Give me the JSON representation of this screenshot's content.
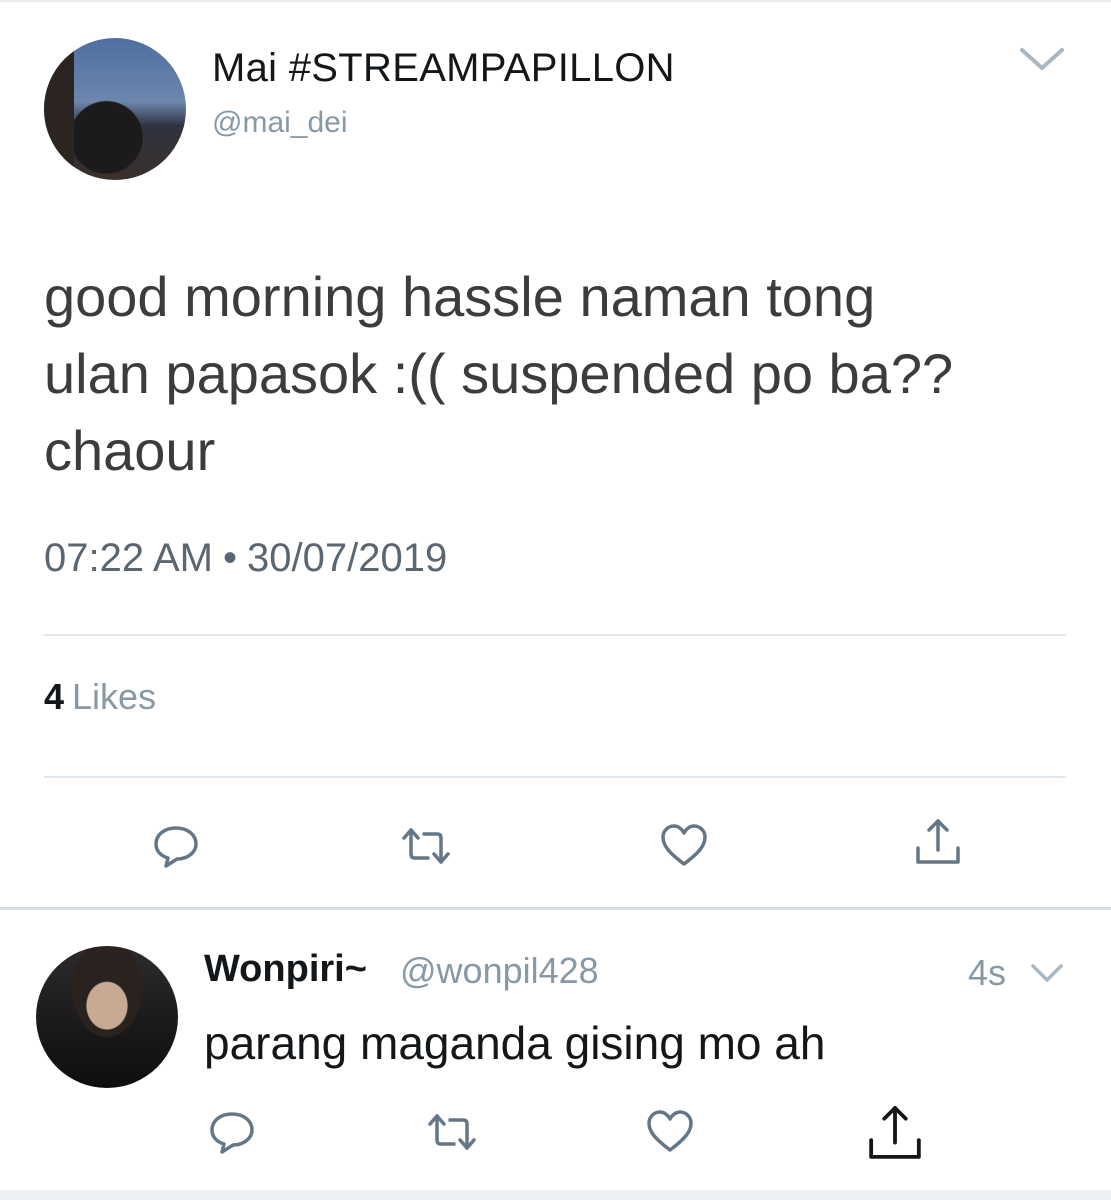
{
  "main_tweet": {
    "display_name": "Mai #STREAMPAPILLON",
    "handle": "@mai_dei",
    "text": "good morning hassle naman tong\nulan papasok :(( suspended po ba??\nchaour",
    "time": "07:22 AM",
    "separator": "•",
    "date": "30/07/2019",
    "likes_count": "4",
    "likes_label": "Likes",
    "menu_icon": "chevron-down-icon",
    "actions": [
      "reply-icon",
      "retweet-icon",
      "like-icon",
      "share-icon"
    ]
  },
  "reply": {
    "display_name": "Wonpiri~",
    "handle": "@wonpil428",
    "time": "4s",
    "text": "parang maganda gising mo ah",
    "menu_icon": "chevron-down-icon",
    "actions": [
      "reply-icon",
      "retweet-icon",
      "like-icon",
      "share-icon"
    ]
  },
  "colors": {
    "text": "#14171a",
    "secondary": "#8899a6",
    "icon": "#657786",
    "divider": "#e1e8ed"
  }
}
